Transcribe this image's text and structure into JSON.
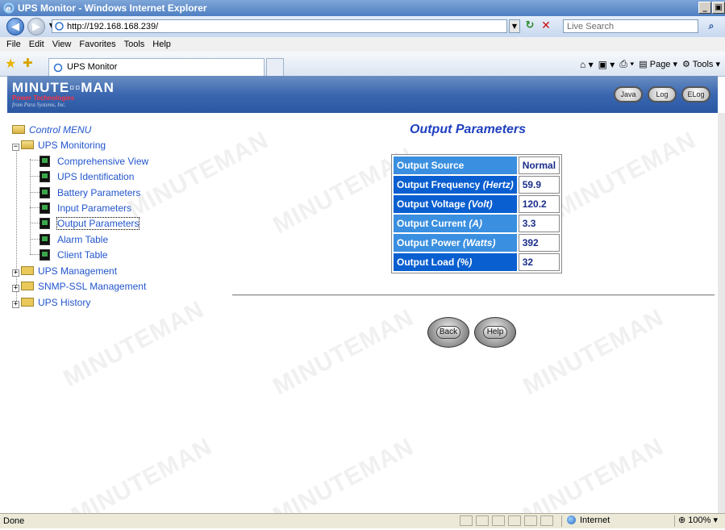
{
  "window": {
    "title": "UPS Monitor - Windows Internet Explorer",
    "buttons": [
      "_",
      "&#9635;",
      "×"
    ]
  },
  "address_bar": {
    "url": "http://192.168.168.239/",
    "search_placeholder": "Live Search"
  },
  "menu": [
    "File",
    "Edit",
    "View",
    "Favorites",
    "Tools",
    "Help"
  ],
  "tab": {
    "label": "UPS Monitor"
  },
  "command_bar": {
    "page_label": "Page",
    "tools_label": "Tools"
  },
  "banner": {
    "logo": "MINUTE▫▫MAN",
    "logo_sub": "Power Technologies",
    "logo_sub2": "from Para Systems, Inc.",
    "buttons": [
      "Java",
      "Log",
      "ELog"
    ]
  },
  "tree": {
    "root": "Control MENU",
    "monitoring": "UPS Monitoring",
    "monitoring_items": [
      "Comprehensive View",
      "UPS Identification",
      "Battery Parameters",
      "Input Parameters",
      "Output Parameters",
      "Alarm Table",
      "Client Table"
    ],
    "collapsed": [
      "UPS Management",
      "SNMP-SSL Management",
      "UPS History"
    ]
  },
  "page": {
    "title": "Output Parameters",
    "rows": [
      {
        "label": "Output Source",
        "unit": "",
        "value": "Normal"
      },
      {
        "label": "Output Frequency",
        "unit": "(Hertz)",
        "value": "59.9"
      },
      {
        "label": "Output Voltage",
        "unit": "(Volt)",
        "value": "120.2"
      },
      {
        "label": "Output Current",
        "unit": "(A)",
        "value": "3.3"
      },
      {
        "label": "Output Power",
        "unit": "(Watts)",
        "value": "392"
      },
      {
        "label": "Output Load",
        "unit": "(%)",
        "value": "32"
      }
    ],
    "back_label": "Back",
    "help_label": "Help"
  },
  "watermark": "MINUTEMAN",
  "status": {
    "text": "Done",
    "zone": "Internet",
    "zoom": "100%"
  }
}
